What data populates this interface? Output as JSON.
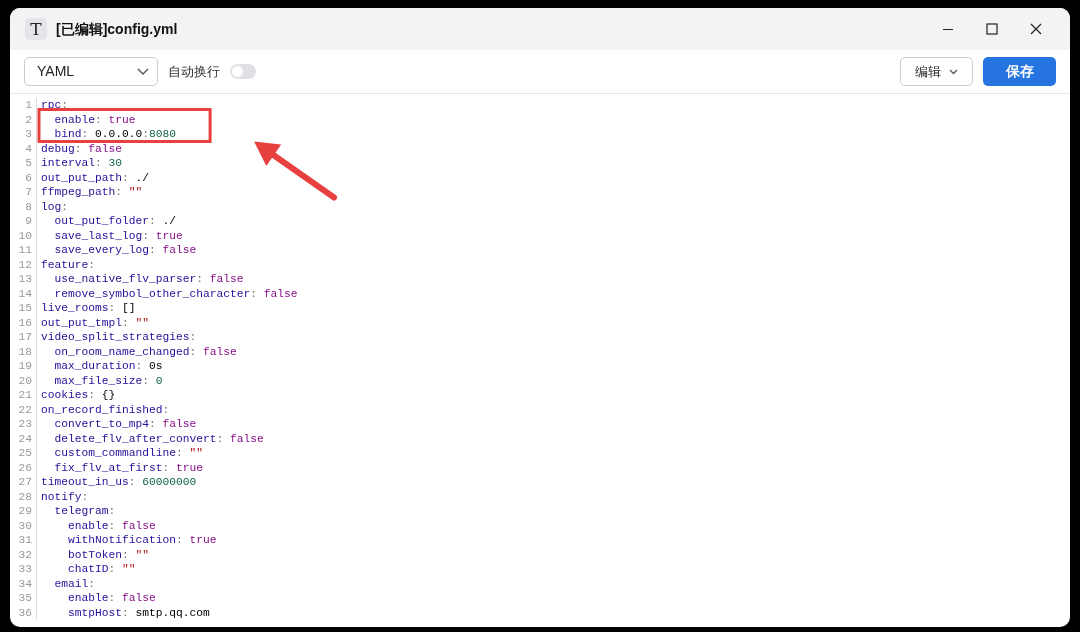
{
  "window": {
    "title": "[已编辑]config.yml",
    "app_icon": "T"
  },
  "toolbar": {
    "language": "YAML",
    "wrap_label": "自动换行",
    "wrap_on": false,
    "edit_menu": "编辑",
    "save": "保存"
  },
  "editor": {
    "lines": [
      {
        "number": "1",
        "boxed": false,
        "tokens": [
          {
            "kind": "key",
            "text": "rpc"
          },
          {
            "kind": "colon",
            "text": ":"
          }
        ]
      },
      {
        "number": "2",
        "boxed": true,
        "tokens": [
          {
            "kind": "key",
            "text": "  enable"
          },
          {
            "kind": "colon",
            "text": ":"
          },
          {
            "kind": "atom",
            "text": " true"
          }
        ]
      },
      {
        "number": "3",
        "boxed": true,
        "tokens": [
          {
            "kind": "key",
            "text": "  bind"
          },
          {
            "kind": "colon",
            "text": ":"
          },
          {
            "kind": "plain",
            "text": " 0.0.0.0"
          },
          {
            "kind": "colon",
            "text": ":"
          },
          {
            "kind": "number",
            "text": "8080"
          }
        ]
      },
      {
        "number": "4",
        "boxed": false,
        "tokens": [
          {
            "kind": "key",
            "text": "debug"
          },
          {
            "kind": "colon",
            "text": ":"
          },
          {
            "kind": "atom",
            "text": " false"
          }
        ]
      },
      {
        "number": "5",
        "boxed": false,
        "tokens": [
          {
            "kind": "key",
            "text": "interval"
          },
          {
            "kind": "colon",
            "text": ":"
          },
          {
            "kind": "number",
            "text": " 30"
          }
        ]
      },
      {
        "number": "6",
        "boxed": false,
        "tokens": [
          {
            "kind": "key",
            "text": "out_put_path"
          },
          {
            "kind": "colon",
            "text": ":"
          },
          {
            "kind": "plain",
            "text": " ./"
          }
        ]
      },
      {
        "number": "7",
        "boxed": false,
        "tokens": [
          {
            "kind": "key",
            "text": "ffmpeg_path"
          },
          {
            "kind": "colon",
            "text": ":"
          },
          {
            "kind": "string",
            "text": " \"\""
          }
        ]
      },
      {
        "number": "8",
        "boxed": false,
        "tokens": [
          {
            "kind": "key",
            "text": "log"
          },
          {
            "kind": "colon",
            "text": ":"
          }
        ]
      },
      {
        "number": "9",
        "boxed": false,
        "tokens": [
          {
            "kind": "key",
            "text": "  out_put_folder"
          },
          {
            "kind": "colon",
            "text": ":"
          },
          {
            "kind": "plain",
            "text": " ./"
          }
        ]
      },
      {
        "number": "10",
        "boxed": false,
        "tokens": [
          {
            "kind": "key",
            "text": "  save_last_log"
          },
          {
            "kind": "colon",
            "text": ":"
          },
          {
            "kind": "atom",
            "text": " true"
          }
        ]
      },
      {
        "number": "11",
        "boxed": false,
        "tokens": [
          {
            "kind": "key",
            "text": "  save_every_log"
          },
          {
            "kind": "colon",
            "text": ":"
          },
          {
            "kind": "atom",
            "text": " false"
          }
        ]
      },
      {
        "number": "12",
        "boxed": false,
        "tokens": [
          {
            "kind": "key",
            "text": "feature"
          },
          {
            "kind": "colon",
            "text": ":"
          }
        ]
      },
      {
        "number": "13",
        "boxed": false,
        "tokens": [
          {
            "kind": "key",
            "text": "  use_native_flv_parser"
          },
          {
            "kind": "colon",
            "text": ":"
          },
          {
            "kind": "atom",
            "text": " false"
          }
        ]
      },
      {
        "number": "14",
        "boxed": false,
        "tokens": [
          {
            "kind": "key",
            "text": "  remove_symbol_other_character"
          },
          {
            "kind": "colon",
            "text": ":"
          },
          {
            "kind": "atom",
            "text": " false"
          }
        ]
      },
      {
        "number": "15",
        "boxed": false,
        "tokens": [
          {
            "kind": "key",
            "text": "live_rooms"
          },
          {
            "kind": "colon",
            "text": ":"
          },
          {
            "kind": "plain",
            "text": " []"
          }
        ]
      },
      {
        "number": "16",
        "boxed": false,
        "tokens": [
          {
            "kind": "key",
            "text": "out_put_tmpl"
          },
          {
            "kind": "colon",
            "text": ":"
          },
          {
            "kind": "string",
            "text": " \"\""
          }
        ]
      },
      {
        "number": "17",
        "boxed": false,
        "tokens": [
          {
            "kind": "key",
            "text": "video_split_strategies"
          },
          {
            "kind": "colon",
            "text": ":"
          }
        ]
      },
      {
        "number": "18",
        "boxed": false,
        "tokens": [
          {
            "kind": "key",
            "text": "  on_room_name_changed"
          },
          {
            "kind": "colon",
            "text": ":"
          },
          {
            "kind": "atom",
            "text": " false"
          }
        ]
      },
      {
        "number": "19",
        "boxed": false,
        "tokens": [
          {
            "kind": "key",
            "text": "  max_duration"
          },
          {
            "kind": "colon",
            "text": ":"
          },
          {
            "kind": "plain",
            "text": " 0s"
          }
        ]
      },
      {
        "number": "20",
        "boxed": false,
        "tokens": [
          {
            "kind": "key",
            "text": "  max_file_size"
          },
          {
            "kind": "colon",
            "text": ":"
          },
          {
            "kind": "number",
            "text": " 0"
          }
        ]
      },
      {
        "number": "21",
        "boxed": false,
        "tokens": [
          {
            "kind": "key",
            "text": "cookies"
          },
          {
            "kind": "colon",
            "text": ":"
          },
          {
            "kind": "plain",
            "text": " {}"
          }
        ]
      },
      {
        "number": "22",
        "boxed": false,
        "tokens": [
          {
            "kind": "key",
            "text": "on_record_finished"
          },
          {
            "kind": "colon",
            "text": ":"
          }
        ]
      },
      {
        "number": "23",
        "boxed": false,
        "tokens": [
          {
            "kind": "key",
            "text": "  convert_to_mp4"
          },
          {
            "kind": "colon",
            "text": ":"
          },
          {
            "kind": "atom",
            "text": " false"
          }
        ]
      },
      {
        "number": "24",
        "boxed": false,
        "tokens": [
          {
            "kind": "key",
            "text": "  delete_flv_after_convert"
          },
          {
            "kind": "colon",
            "text": ":"
          },
          {
            "kind": "atom",
            "text": " false"
          }
        ]
      },
      {
        "number": "25",
        "boxed": false,
        "tokens": [
          {
            "kind": "key",
            "text": "  custom_commandline"
          },
          {
            "kind": "colon",
            "text": ":"
          },
          {
            "kind": "string",
            "text": " \"\""
          }
        ]
      },
      {
        "number": "26",
        "boxed": false,
        "tokens": [
          {
            "kind": "key",
            "text": "  fix_flv_at_first"
          },
          {
            "kind": "colon",
            "text": ":"
          },
          {
            "kind": "atom",
            "text": " true"
          }
        ]
      },
      {
        "number": "27",
        "boxed": false,
        "tokens": [
          {
            "kind": "key",
            "text": "timeout_in_us"
          },
          {
            "kind": "colon",
            "text": ":"
          },
          {
            "kind": "number",
            "text": " 60000000"
          }
        ]
      },
      {
        "number": "28",
        "boxed": false,
        "tokens": [
          {
            "kind": "key",
            "text": "notify"
          },
          {
            "kind": "colon",
            "text": ":"
          }
        ]
      },
      {
        "number": "29",
        "boxed": false,
        "tokens": [
          {
            "kind": "key",
            "text": "  telegram"
          },
          {
            "kind": "colon",
            "text": ":"
          }
        ]
      },
      {
        "number": "30",
        "boxed": false,
        "tokens": [
          {
            "kind": "key",
            "text": "    enable"
          },
          {
            "kind": "colon",
            "text": ":"
          },
          {
            "kind": "atom",
            "text": " false"
          }
        ]
      },
      {
        "number": "31",
        "boxed": false,
        "tokens": [
          {
            "kind": "key",
            "text": "    withNotification"
          },
          {
            "kind": "colon",
            "text": ":"
          },
          {
            "kind": "atom",
            "text": " true"
          }
        ]
      },
      {
        "number": "32",
        "boxed": false,
        "tokens": [
          {
            "kind": "key",
            "text": "    botToken"
          },
          {
            "kind": "colon",
            "text": ":"
          },
          {
            "kind": "string",
            "text": " \"\""
          }
        ]
      },
      {
        "number": "33",
        "boxed": false,
        "tokens": [
          {
            "kind": "key",
            "text": "    chatID"
          },
          {
            "kind": "colon",
            "text": ":"
          },
          {
            "kind": "string",
            "text": " \"\""
          }
        ]
      },
      {
        "number": "34",
        "boxed": false,
        "tokens": [
          {
            "kind": "key",
            "text": "  email"
          },
          {
            "kind": "colon",
            "text": ":"
          }
        ]
      },
      {
        "number": "35",
        "boxed": false,
        "tokens": [
          {
            "kind": "key",
            "text": "    enable"
          },
          {
            "kind": "colon",
            "text": ":"
          },
          {
            "kind": "atom",
            "text": " false"
          }
        ]
      },
      {
        "number": "36",
        "boxed": false,
        "tokens": [
          {
            "kind": "key",
            "text": "    smtpHost"
          },
          {
            "kind": "colon",
            "text": ":"
          },
          {
            "kind": "plain",
            "text": " smtp.qq.com"
          }
        ]
      }
    ]
  },
  "annotation": {
    "kind": "box-and-arrow",
    "color": "#e8403f"
  }
}
